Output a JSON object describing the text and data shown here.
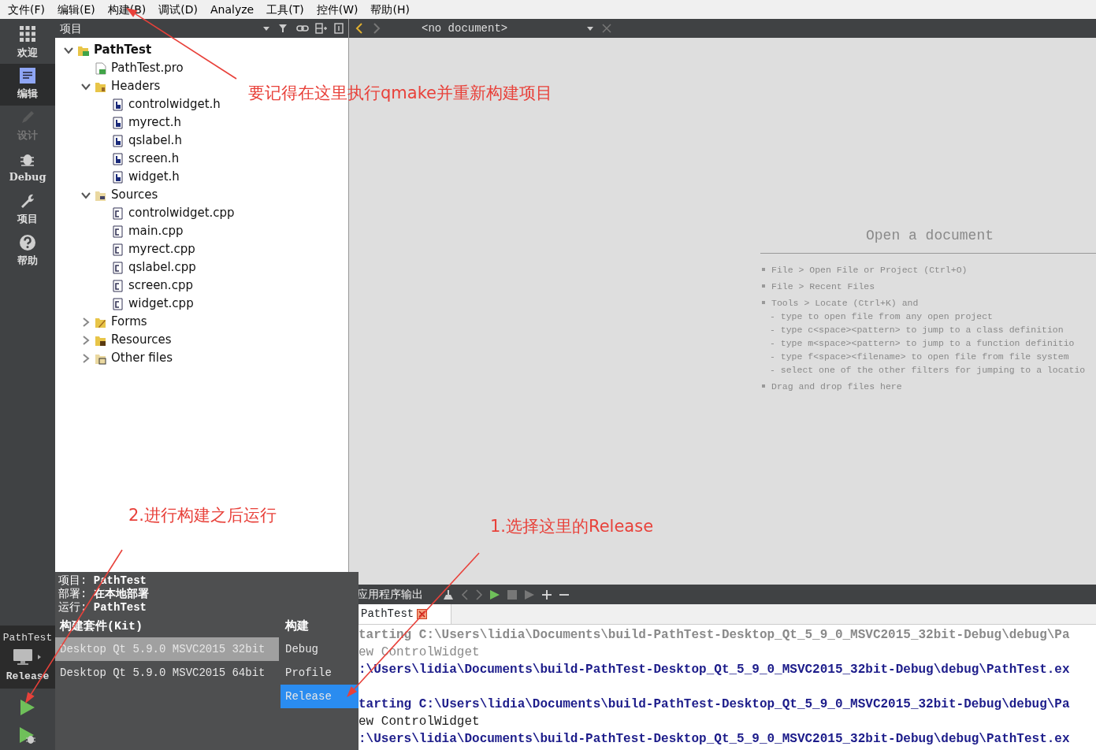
{
  "menu": [
    {
      "label": "文件(F)"
    },
    {
      "label": "编辑(E)"
    },
    {
      "label": "构建(B)"
    },
    {
      "label": "调试(D)"
    },
    {
      "label": "Analyze"
    },
    {
      "label": "工具(T)"
    },
    {
      "label": "控件(W)"
    },
    {
      "label": "帮助(H)"
    }
  ],
  "mode_bar": {
    "modes": [
      {
        "label": "欢迎",
        "kind": "welcome",
        "selected": false,
        "disabled": false
      },
      {
        "label": "编辑",
        "kind": "edit",
        "selected": true,
        "disabled": false
      },
      {
        "label": "设计",
        "kind": "design",
        "selected": false,
        "disabled": true
      },
      {
        "label": "Debug",
        "kind": "debug",
        "selected": false,
        "disabled": false
      },
      {
        "label": "项目",
        "kind": "projects",
        "selected": false,
        "disabled": false
      },
      {
        "label": "帮助",
        "kind": "help",
        "selected": false,
        "disabled": false
      }
    ],
    "kit_selector": {
      "project": "PathTest",
      "build": "Release"
    }
  },
  "project_panel": {
    "title": "项目",
    "tree": [
      {
        "label": "PathTest",
        "kind": "project",
        "expanded": true,
        "children": [
          {
            "label": "PathTest.pro",
            "kind": "pro"
          },
          {
            "label": "Headers",
            "kind": "headers",
            "expanded": true,
            "children": [
              {
                "label": "controlwidget.h",
                "kind": "header"
              },
              {
                "label": "myrect.h",
                "kind": "header"
              },
              {
                "label": "qslabel.h",
                "kind": "header"
              },
              {
                "label": "screen.h",
                "kind": "header"
              },
              {
                "label": "widget.h",
                "kind": "header"
              }
            ]
          },
          {
            "label": "Sources",
            "kind": "sources",
            "expanded": true,
            "children": [
              {
                "label": "controlwidget.cpp",
                "kind": "source"
              },
              {
                "label": "main.cpp",
                "kind": "source"
              },
              {
                "label": "myrect.cpp",
                "kind": "source"
              },
              {
                "label": "qslabel.cpp",
                "kind": "source"
              },
              {
                "label": "screen.cpp",
                "kind": "source"
              },
              {
                "label": "widget.cpp",
                "kind": "source"
              }
            ]
          },
          {
            "label": "Forms",
            "kind": "forms",
            "expanded": false
          },
          {
            "label": "Resources",
            "kind": "resources",
            "expanded": false
          },
          {
            "label": "Other files",
            "kind": "other",
            "expanded": false
          }
        ]
      }
    ]
  },
  "editor": {
    "document": "<no document>",
    "heading": "Open a document",
    "hints": [
      {
        "kind": "item",
        "text": "File > Open File or Project (Ctrl+O)"
      },
      {
        "kind": "item",
        "text": "File > Recent Files"
      },
      {
        "kind": "item",
        "text": "Tools > Locate (Ctrl+K) and"
      },
      {
        "kind": "sub",
        "text": "- type to open file from any open project"
      },
      {
        "kind": "sub",
        "text": "- type c<space><pattern> to jump to a class definition"
      },
      {
        "kind": "sub",
        "text": "- type m<space><pattern> to jump to a function definitio"
      },
      {
        "kind": "sub",
        "text": "- type f<space><filename> to open file from file system"
      },
      {
        "kind": "sub",
        "text": "- select one of the other filters for jumping to a locatio"
      },
      {
        "kind": "item",
        "text": "Drag and drop files here"
      }
    ]
  },
  "output_pane": {
    "title": "应用程序输出",
    "tab": "PathTest",
    "lines": [
      {
        "kind": "start",
        "stale": true,
        "text": "tarting C:\\Users\\lidia\\Documents\\build-PathTest-Desktop_Qt_5_9_0_MSVC2015_32bit-Debug\\debug\\Pa"
      },
      {
        "kind": "output",
        "stale": true,
        "text": "ew ControlWidget"
      },
      {
        "kind": "exit",
        "stale": false,
        "text": ":\\Users\\lidia\\Documents\\build-PathTest-Desktop_Qt_5_9_0_MSVC2015_32bit-Debug\\debug\\PathTest.ex"
      },
      {
        "kind": "start",
        "stale": false,
        "gap_before": true,
        "text": "tarting C:\\Users\\lidia\\Documents\\build-PathTest-Desktop_Qt_5_9_0_MSVC2015_32bit-Debug\\debug\\Pa"
      },
      {
        "kind": "output",
        "stale": false,
        "text": "ew ControlWidget"
      },
      {
        "kind": "exit",
        "stale": false,
        "text": ":\\Users\\lidia\\Documents\\build-PathTest-Desktop_Qt_5_9_0_MSVC2015_32bit-Debug\\debug\\PathTest.ex"
      }
    ]
  },
  "target_popup": {
    "info": [
      "项目: **PathTest**",
      "部署: **在本地部署**",
      "运行: **PathTest**"
    ],
    "kit_header": "构建套件(Kit)",
    "build_header": "构建",
    "kits": [
      {
        "label": "Desktop Qt 5.9.0 MSVC2015 32bit",
        "selected": true
      },
      {
        "label": "Desktop Qt 5.9.0 MSVC2015 64bit",
        "selected": false
      }
    ],
    "builds": [
      {
        "label": "Debug",
        "selected": false
      },
      {
        "label": "Profile",
        "selected": false
      },
      {
        "label": "Release",
        "selected": true
      }
    ]
  },
  "annotations": [
    {
      "text": "要记得在这里执行qmake并重新构建项目"
    },
    {
      "text": "2.进行构建之后运行"
    },
    {
      "text": "1.选择这里的Release"
    }
  ]
}
